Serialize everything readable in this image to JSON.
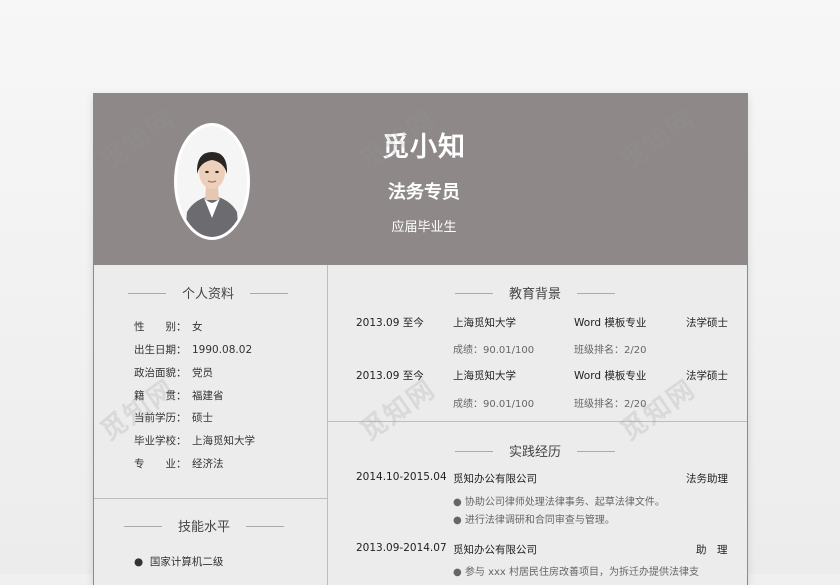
{
  "profile": {
    "name": "觅小知",
    "title": "法务专员",
    "subtitle": "应届毕业生"
  },
  "personal": {
    "heading": "个人资料",
    "items": [
      {
        "label": "性　　别：",
        "value": "女"
      },
      {
        "label": "出生日期：",
        "value": "1990.08.02"
      },
      {
        "label": "政治面貌：",
        "value": "党员"
      },
      {
        "label": "籍　　贯：",
        "value": "福建省"
      },
      {
        "label": "当前学历：",
        "value": "硕士"
      },
      {
        "label": "毕业学校：",
        "value": "上海觅知大学"
      },
      {
        "label": "专　　业：",
        "value": "经济法"
      }
    ]
  },
  "skills": {
    "heading": "技能水平",
    "items": [
      "国家计算机二级"
    ]
  },
  "education": {
    "heading": "教育背景",
    "rows": [
      {
        "date": "2013.09  至今",
        "school": "上海觅知大学",
        "major": "Word 模板专业",
        "degree": "法学硕士",
        "score": "成绩：90.01/100",
        "rank": "班级排名：2/20"
      },
      {
        "date": "2013.09  至今",
        "school": "上海觅知大学",
        "major": "Word 模板专业",
        "degree": "法学硕士",
        "score": "成绩：90.01/100",
        "rank": "班级排名：2/20"
      }
    ]
  },
  "practice": {
    "heading": "实践经历",
    "rows": [
      {
        "date": "2014.10-2015.04",
        "company": "觅知办公有限公司",
        "role": "法务助理",
        "bullets": [
          "协助公司律师处理法律事务、起草法律文件。",
          "进行法律调研和合同审查与管理。"
        ]
      },
      {
        "date": "2013.09-2014.07",
        "company": "觅知办公有限公司",
        "role": "助　理",
        "bullets": [
          "参与 xxx 村居民住房改善项目，为拆迁办提供法律支"
        ]
      }
    ]
  },
  "watermark": "觅知网"
}
